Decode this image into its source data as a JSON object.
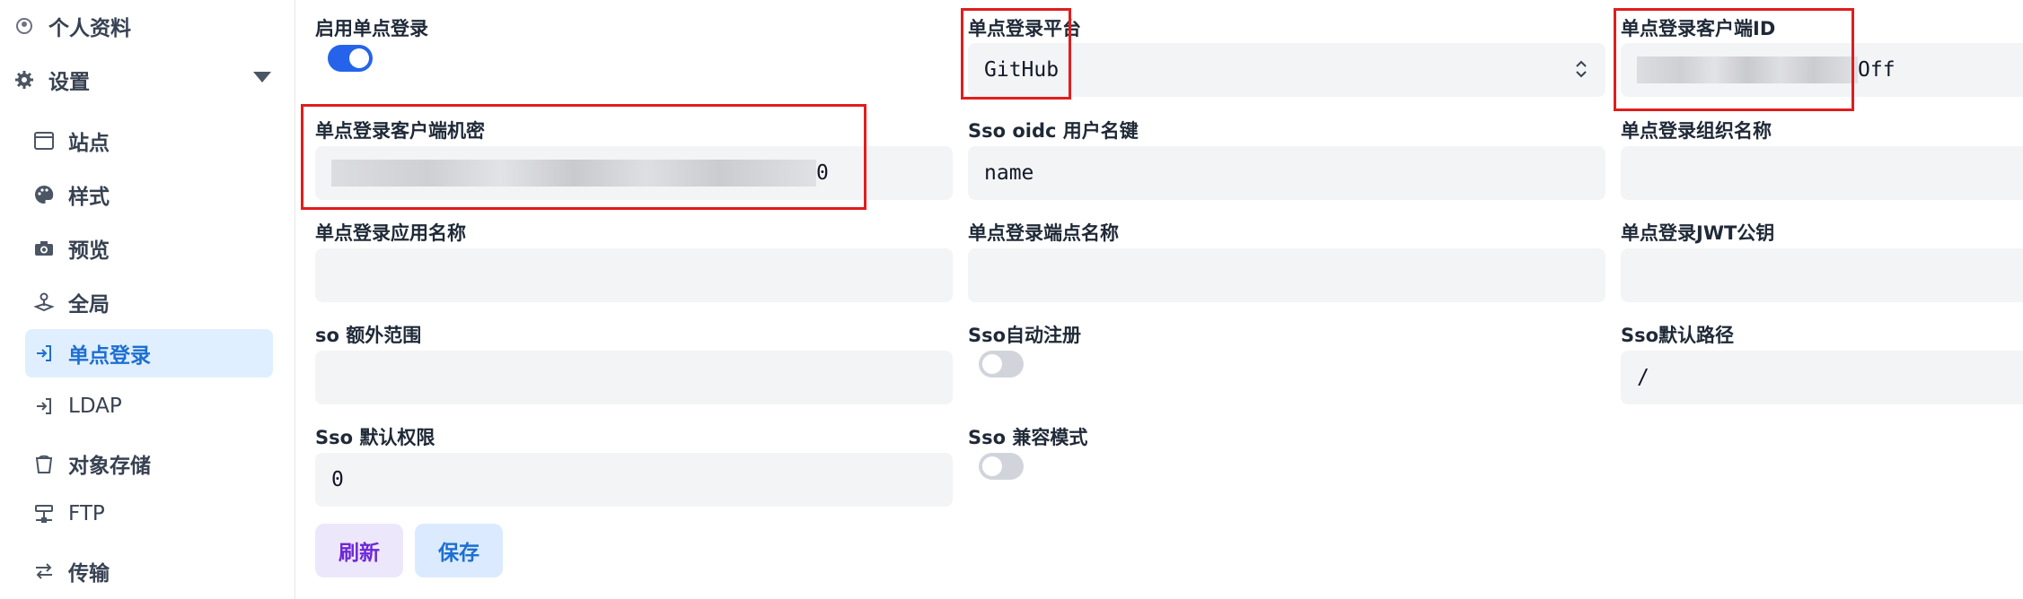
{
  "sidebar": {
    "profile": "个人资料",
    "settings": "设置",
    "items": [
      {
        "label": "站点",
        "icon": "browser-window-icon"
      },
      {
        "label": "样式",
        "icon": "palette-icon"
      },
      {
        "label": "预览",
        "icon": "camera-icon"
      },
      {
        "label": "全局",
        "icon": "joystick-icon"
      },
      {
        "label": "单点登录",
        "icon": "login-arrow-icon",
        "active": true
      },
      {
        "label": "LDAP",
        "icon": "login-arrow-icon"
      },
      {
        "label": "对象存储",
        "icon": "bucket-icon"
      },
      {
        "label": "FTP",
        "icon": "server-icon"
      },
      {
        "label": "传输",
        "icon": "transfer-arrows-icon"
      }
    ]
  },
  "form": {
    "enable_sso": {
      "label": "启用单点登录",
      "value": true
    },
    "platform": {
      "label": "单点登录平台",
      "value": "GitHub"
    },
    "client_id": {
      "label": "单点登录客户端ID",
      "visible_suffix": "Off"
    },
    "client_secret": {
      "label": "单点登录客户端机密",
      "visible_suffix": "0"
    },
    "oidc_username_key": {
      "label": "Sso oidc 用户名键",
      "value": "name"
    },
    "org_name": {
      "label": "单点登录组织名称",
      "value": ""
    },
    "app_name": {
      "label": "单点登录应用名称",
      "value": ""
    },
    "endpoint_name": {
      "label": "单点登录端点名称",
      "value": ""
    },
    "jwt_public_key": {
      "label": "单点登录JWT公钥",
      "value": ""
    },
    "extra_scopes": {
      "label": "so 额外范围",
      "value": ""
    },
    "auto_register": {
      "label": "Sso自动注册",
      "value": false
    },
    "default_path": {
      "label": "Sso默认路径",
      "value": "/"
    },
    "default_permission": {
      "label": "Sso 默认权限",
      "value": "0"
    },
    "compat_mode": {
      "label": "Sso 兼容模式",
      "value": false
    }
  },
  "buttons": {
    "refresh": "刷新",
    "save": "保存"
  },
  "colors": {
    "accent": "#2563eb",
    "highlight_box": "#e11d1d"
  }
}
